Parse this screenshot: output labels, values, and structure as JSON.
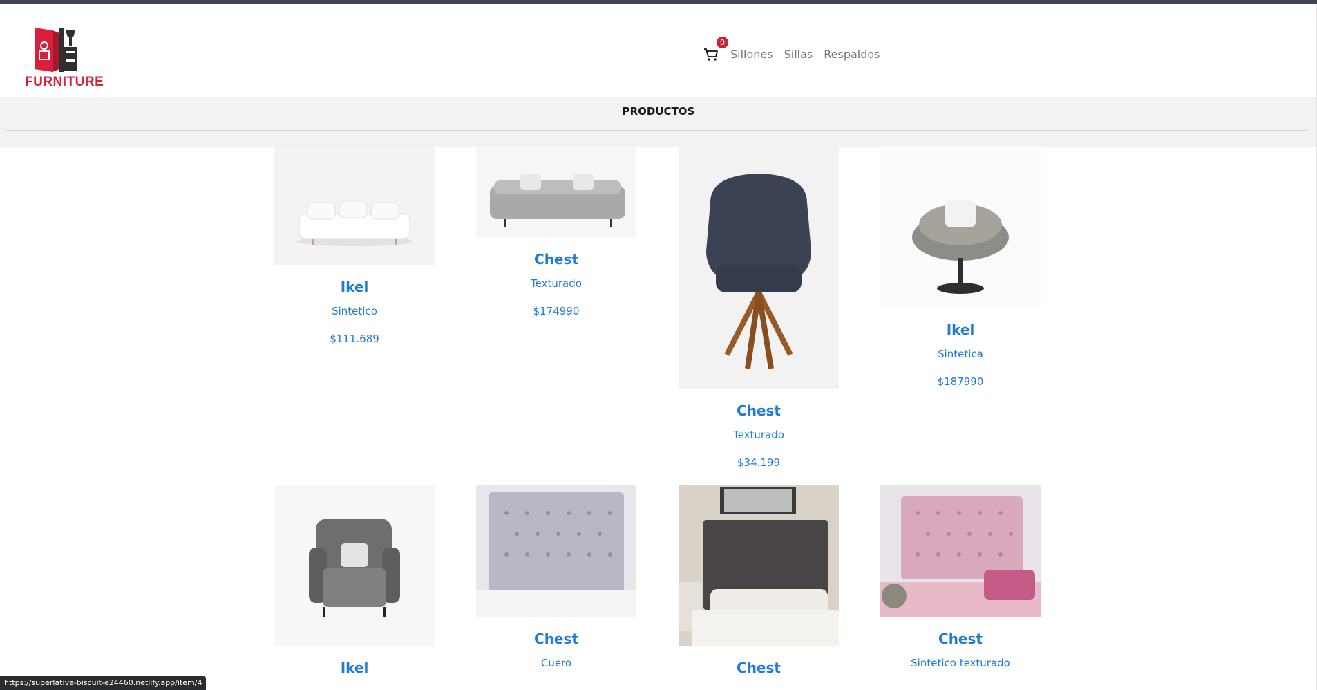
{
  "header": {
    "logo_text": "FURNITURE",
    "cart_count": "0",
    "nav": [
      "Sillones",
      "Sillas",
      "Respaldos"
    ]
  },
  "section": {
    "title": "PRODUCTOS"
  },
  "products": [
    {
      "name": "Ikel",
      "material": "Sintetico",
      "price": "$111.689",
      "image": "white-sofa"
    },
    {
      "name": "Chest",
      "material": "Texturado",
      "price": "$174990",
      "image": "gray-sofa"
    },
    {
      "name": "Chest",
      "material": "Texturado",
      "price": "$34.199",
      "image": "navy-chair"
    },
    {
      "name": "Ikel",
      "material": "Sintetica",
      "price": "$187990",
      "image": "swivel-armchair"
    },
    {
      "name": "Ikel",
      "material": "",
      "price": "",
      "image": "wingback-armchair"
    },
    {
      "name": "Chest",
      "material": "Cuero",
      "price": "",
      "image": "lavender-headboard"
    },
    {
      "name": "Chest",
      "material": "",
      "price": "",
      "image": "dark-headboard"
    },
    {
      "name": "Chest",
      "material": "Sintetico texturado",
      "price": "",
      "image": "pink-headboard"
    }
  ],
  "status_bar": {
    "url": "https://superlative-biscuit-e24460.netlify.app/item/4"
  },
  "colors": {
    "brand": "#d8203d",
    "link": "#1f7ad8",
    "badge": "#c82333",
    "topbar": "#3e474f"
  }
}
